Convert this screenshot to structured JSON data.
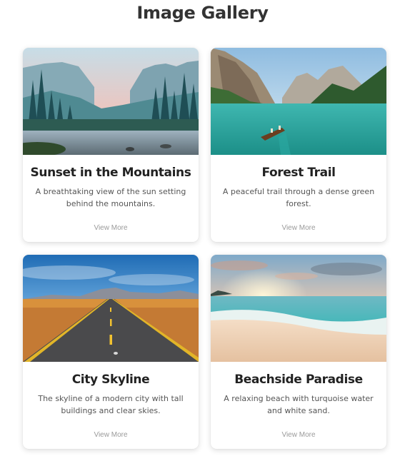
{
  "page": {
    "title": "Image Gallery"
  },
  "gallery": {
    "cards": [
      {
        "title": "Sunset in the Mountains",
        "description": "A breathtaking view of the sun setting behind the mountains.",
        "link": "View More",
        "image": "mountain-sunset-lake-photo"
      },
      {
        "title": "Forest Trail",
        "description": "A peaceful trail through a dense green forest.",
        "link": "View More",
        "image": "turquoise-lake-boat-photo"
      },
      {
        "title": "City Skyline",
        "description": "The skyline of a modern city with tall buildings and clear skies.",
        "link": "View More",
        "image": "desert-road-photo"
      },
      {
        "title": "Beachside Paradise",
        "description": "A relaxing beach with turquoise water and white sand.",
        "link": "View More",
        "image": "beach-sunset-photo"
      }
    ]
  }
}
